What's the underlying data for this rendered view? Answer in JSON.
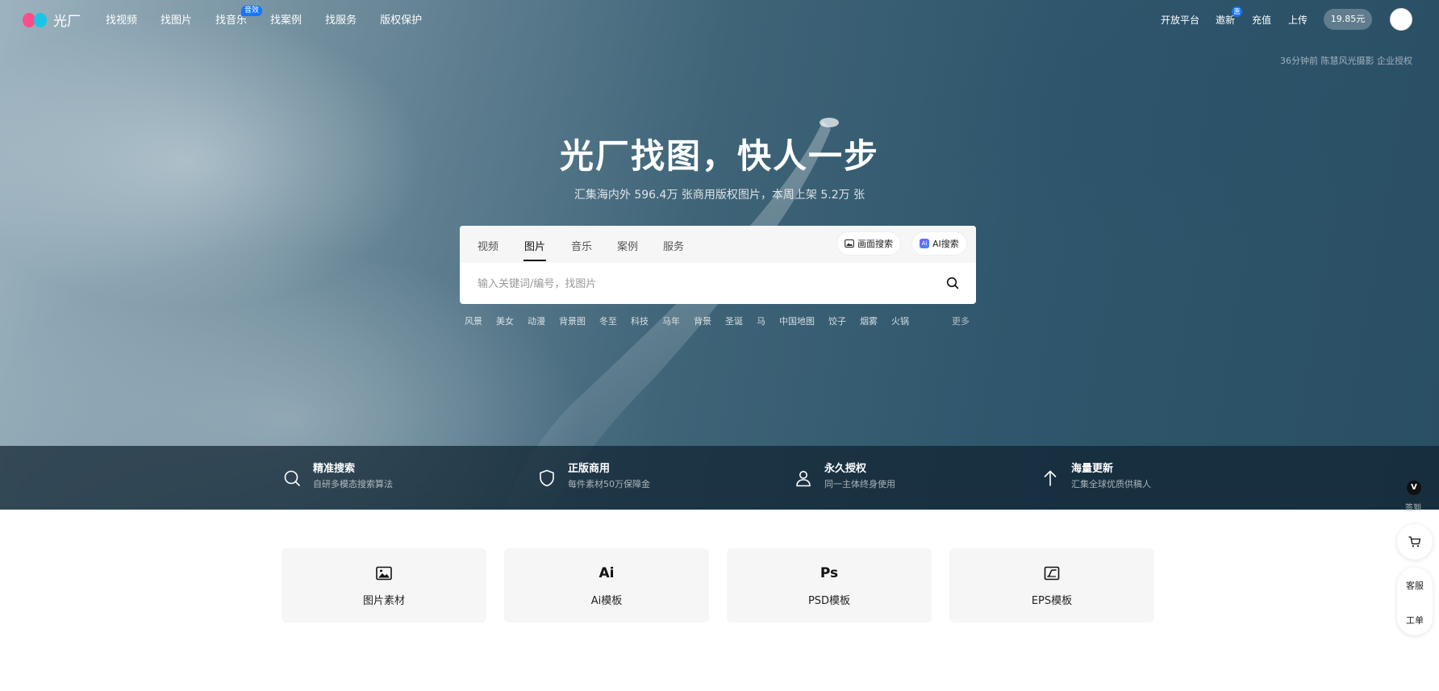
{
  "nav": {
    "logo_text": "光厂",
    "links": [
      "找视频",
      "找图片",
      "找音乐",
      "找案例",
      "找服务",
      "版权保护"
    ],
    "music_badge": "音效",
    "right": {
      "open_platform": "开放平台",
      "invite": "邀新",
      "invite_badge": "惠",
      "recharge": "充值",
      "upload": "上传",
      "balance": "19.85元"
    }
  },
  "hero": {
    "credit": "36分钟前 陈慧风光摄影 企业授权",
    "headline": "光厂找图，快人一步",
    "subline": "汇集海内外 596.4万 张商用版权图片，本周上架 5.2万 张"
  },
  "search": {
    "tabs": [
      "视频",
      "图片",
      "音乐",
      "案例",
      "服务"
    ],
    "active_tab": "图片",
    "image_search_label": "画面搜索",
    "ai_search_label": "AI搜索",
    "ai_icon_text": "Ai",
    "placeholder": "输入关键词/编号，找图片",
    "value": ""
  },
  "hot_tags": [
    "风景",
    "美女",
    "动漫",
    "背景图",
    "冬至",
    "科技",
    "马年",
    "背景",
    "圣诞",
    "马",
    "中国地图",
    "饺子",
    "烟雾",
    "火锅"
  ],
  "more_label": "更多",
  "features": [
    {
      "icon": "search-icon",
      "title": "精准搜索",
      "desc": "自研多模态搜索算法"
    },
    {
      "icon": "shield-icon",
      "title": "正版商用",
      "desc": "每件素材50万保障金"
    },
    {
      "icon": "user-icon",
      "title": "永久授权",
      "desc": "同一主体终身使用"
    },
    {
      "icon": "arrow-up-icon",
      "title": "海量更新",
      "desc": "汇集全球优质供稿人"
    }
  ],
  "categories": [
    {
      "icon": "image-icon",
      "label": "图片素材"
    },
    {
      "icon": "ai-icon",
      "glyph": "Ai",
      "label": "Ai模板"
    },
    {
      "icon": "ps-icon",
      "glyph": "Ps",
      "label": "PSD模板"
    },
    {
      "icon": "eps-icon",
      "label": "EPS模板"
    }
  ],
  "sidebar": {
    "vip_badge": "V",
    "checkin_label": "签到",
    "service_label": "客服",
    "ticket_label": "工单"
  },
  "colors": {
    "accent_blue": "#1677ff",
    "logo_pink": "#ff4d8b",
    "logo_cyan": "#19c6e6"
  }
}
